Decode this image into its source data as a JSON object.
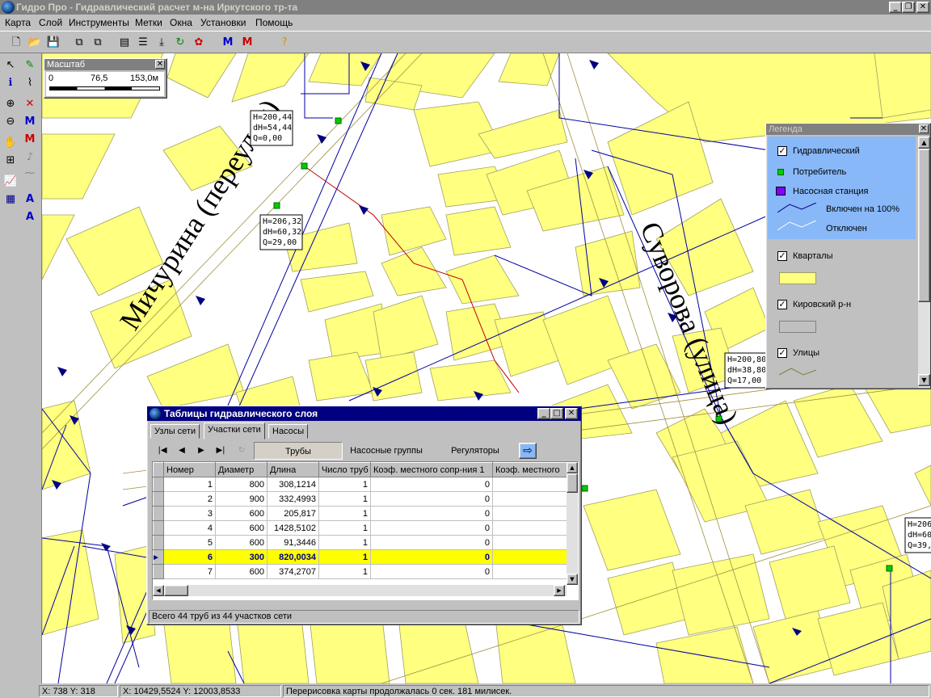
{
  "window": {
    "title": "Гидро Про - Гидравлический расчет м-на Иркутского тр-та"
  },
  "menu": [
    "Карта",
    "Слой",
    "Инструменты",
    "Метки",
    "Окна",
    "Установки",
    "Помощь"
  ],
  "scale_panel": {
    "title": "Масштаб",
    "labels": [
      "0",
      "76,5",
      "153,0м"
    ]
  },
  "map": {
    "streets": [
      "Мичурина (переулок)",
      "Суворова (улица)"
    ],
    "callouts": [
      {
        "H": "H=200,44",
        "dH": "dH=54,44",
        "Q": "Q=0,00"
      },
      {
        "H": "H=206,32",
        "dH": "dH=60,32",
        "Q": "Q=29,00"
      },
      {
        "H": "H=200,80",
        "dH": "dH=38,80",
        "Q": "Q=17,00"
      },
      {
        "H": "H=206",
        "dH": "dH=60",
        "Q": "Q=39,"
      }
    ]
  },
  "legend": {
    "title": "Легенда",
    "items": [
      "Гидравлический",
      "Потребитель",
      "Насосная станция",
      "Включен на 100%",
      "Отключен",
      "Кварталы",
      "Кировский р-н",
      "Улицы"
    ],
    "colors": {
      "consumer": "#00cc00",
      "pump": "#8000ff",
      "highlight": "#88b8f8",
      "block": "#ffff80",
      "district": "#c0c0c0"
    }
  },
  "table_window": {
    "title": "Таблицы гидравлического слоя",
    "tabs": [
      "Узлы сети",
      "Участки сети",
      "Насосы"
    ],
    "subtabs": [
      "Трубы",
      "Насосные группы",
      "Регуляторы"
    ],
    "columns": [
      "Номер",
      "Диаметр",
      "Длина",
      "Число труб",
      "Коэф. местного сопр-ния 1",
      "Коэф. местного"
    ],
    "rows": [
      [
        "1",
        "800",
        "308,1214",
        "1",
        "0",
        ""
      ],
      [
        "2",
        "900",
        "332,4993",
        "1",
        "0",
        ""
      ],
      [
        "3",
        "600",
        "205,817",
        "1",
        "0",
        ""
      ],
      [
        "4",
        "600",
        "1428,5102",
        "1",
        "0",
        ""
      ],
      [
        "5",
        "600",
        "91,3446",
        "1",
        "0",
        ""
      ],
      [
        "6",
        "300",
        "820,0034",
        "1",
        "0",
        ""
      ],
      [
        "7",
        "600",
        "374,2707",
        "1",
        "0",
        ""
      ]
    ],
    "selected_row": 5,
    "status": "Всего 44 труб из 44 участков сети"
  },
  "status": {
    "xy": "X: 738  Y: 318",
    "coords": "X: 10429,5524  Y: 12003,8533",
    "message": "Перерисовка карты продолжалась 0 сек. 181 милисек."
  }
}
